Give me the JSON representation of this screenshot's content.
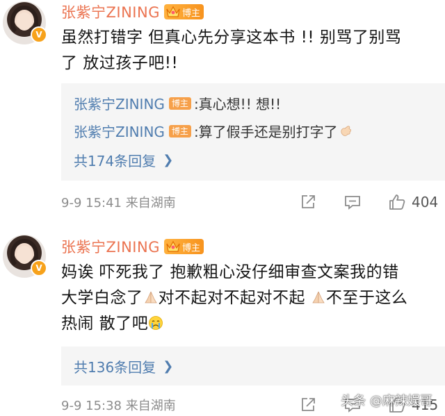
{
  "comments": [
    {
      "author": "张紫宁ZINING",
      "author_tag": "博主",
      "verified_badge": "V",
      "text_lines": [
        "虽然打错字 但真心先分享这本书 !! 别骂了别骂",
        "了 放过孩子吧!!"
      ],
      "replies": [
        {
          "name": "张紫宁ZINING",
          "tag": "博主",
          "text": ":真心想!! 想!!"
        },
        {
          "name": "张紫宁ZINING",
          "tag": "博主",
          "text": ":算了假手还是别打字了"
        }
      ],
      "more_replies": "共174条回复",
      "meta": "9-9 15:41 来自湖南",
      "likes": "404"
    },
    {
      "author": "张紫宁ZINING",
      "author_tag": "博主",
      "verified_badge": "V",
      "text_line1": "妈诶 吓死我了 抱歉粗心没仔细审查文案我的错",
      "text_line2a": "大学白念了",
      "text_line2b": "对不起对不起对不起 ",
      "text_line2c": "不至于这么",
      "text_line3": "热闹 散了吧",
      "more_replies": "共136条回复",
      "meta": "9-9 15:38 来自湖南",
      "likes": "415"
    }
  ],
  "watermark": "头条 @麻辣娱哥",
  "icons": {
    "share": "share-icon",
    "comment": "comment-icon",
    "like": "thumbs-up-icon",
    "pray": "pray-emoji",
    "clap": "clap-emoji",
    "cry": "crying-emoji",
    "crown": "crown-icon"
  },
  "colors": {
    "name": "#eb7350",
    "link": "#507daf",
    "tag": "#f7931e"
  }
}
